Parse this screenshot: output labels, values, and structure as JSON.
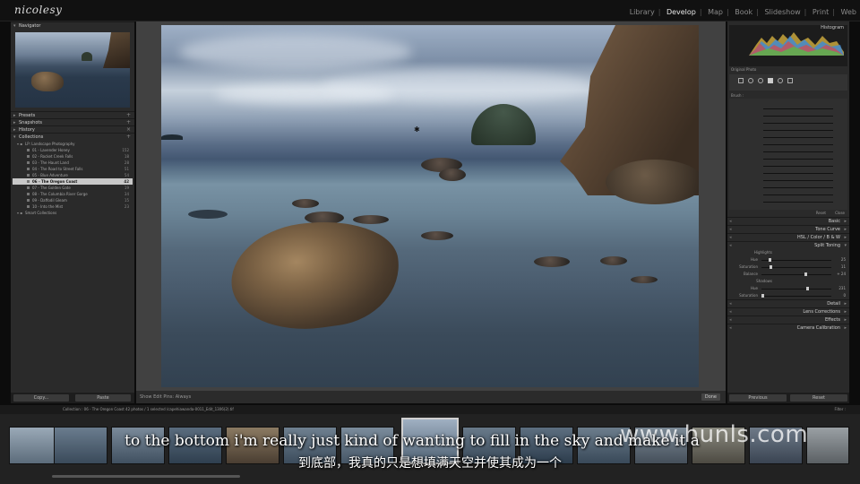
{
  "app": {
    "logo": "nicolesy",
    "modules": [
      "Library",
      "Develop",
      "Map",
      "Book",
      "Slideshow",
      "Print",
      "Web"
    ],
    "active_module": "Develop"
  },
  "left_panel": {
    "navigator_label": "Navigator",
    "presets_label": "Presets",
    "snapshots_label": "Snapshots",
    "history_label": "History",
    "collections_label": "Collections",
    "collections_parent": "LP: Landscape Photography",
    "collections": [
      {
        "name": "01 - Lavender Honey",
        "count": "152"
      },
      {
        "name": "02 - Rocket Creek Falls",
        "count": "18"
      },
      {
        "name": "03 - The Haunt Land",
        "count": "28"
      },
      {
        "name": "04 - The Road to Street Falls",
        "count": "51"
      },
      {
        "name": "05 - Blue Adventure",
        "count": "54"
      },
      {
        "name": "06 - The Oregon Coast",
        "count": "42",
        "selected": true
      },
      {
        "name": "07 - The Golden Gate",
        "count": "19"
      },
      {
        "name": "08 - The Columbia River Gorge",
        "count": "34"
      },
      {
        "name": "09 - Daffodil Gleam",
        "count": "15"
      },
      {
        "name": "10 - Into the Mist",
        "count": "23"
      }
    ],
    "smart_collections": "Smart Collections",
    "copy_button": "Copy...",
    "paste_button": "Paste"
  },
  "center_toolbar": {
    "label": "Show Edit Pins: Always",
    "done_button": "Done"
  },
  "right_panel": {
    "histogram_label": "Histogram",
    "original_photo": "Original Photo",
    "basic_label": "Basic",
    "tone_curve_label": "Tone Curve",
    "hsl_label": "HSL / Color / B & W",
    "split_toning_label": "Split Toning",
    "highlights_label": "Highlights",
    "shadows_label": "Shadows",
    "hue_label": "Hue",
    "saturation_label": "Saturation",
    "balance_label": "Balance",
    "highlights_hue": "25",
    "highlights_sat": "11",
    "balance_val": "+ 24",
    "shadows_hue": "231",
    "shadows_sat": "0",
    "detail_label": "Detail",
    "lens_label": "Lens Corrections",
    "effects_label": "Effects",
    "camera_label": "Camera Calibration",
    "previous_button": "Previous",
    "reset_button": "Reset",
    "brush_label": "Brush :",
    "reset_small": "Reset",
    "close_small": "Close"
  },
  "filmstrip": {
    "info": "Collection : 06 - The Oregon Coast    42 photos / 1 selected    /capehiawanda-0011_Edit_1306(2).tif",
    "filter": "Filter :"
  },
  "overlay": {
    "subtitle_en": "to the bottom i'm really just kind of wanting to fill in the sky and make it a",
    "subtitle_cn": "到底部，我真的只是想填满天空并使其成为一个",
    "watermark": "www.hunls.com"
  },
  "colors": {
    "panel_bg": "#2a2a2a",
    "center_bg": "#414141",
    "selected_collection": "#c8c8c8"
  }
}
